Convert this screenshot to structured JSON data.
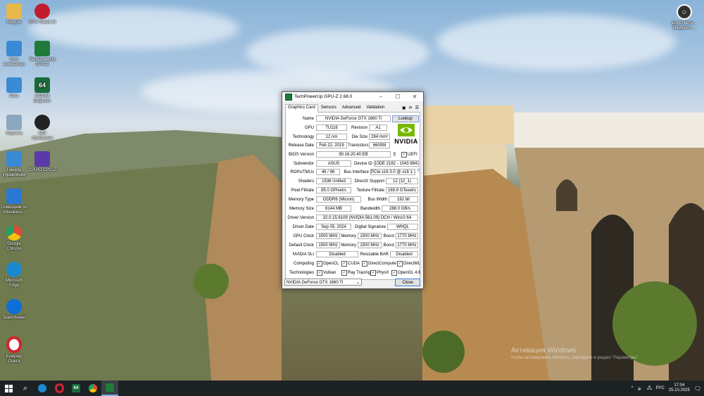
{
  "desktop_icons": [
    {
      "label": "Вхидин",
      "icon": "folder-icon",
      "color": "#e8b84a"
    },
    {
      "label": "GPU Tweak III",
      "icon": "gpu-tweak-icon",
      "color": "#c21d2e"
    },
    {
      "label": "Этот компьютер",
      "icon": "computer-icon",
      "color": "#3a8ad6"
    },
    {
      "label": "TechPowerUp GPU-Z",
      "icon": "gpuz-icon",
      "color": "#1e7b3a"
    },
    {
      "label": "Сеть",
      "icon": "network-icon",
      "color": "#3a8ad6"
    },
    {
      "label": "AIDA64 Engineer",
      "icon": "aida64-icon",
      "color": "#1a6b3a",
      "glyph": "64"
    },
    {
      "label": "Корзина",
      "icon": "recycle-bin-icon",
      "color": "#8aa7c0"
    },
    {
      "label": "MSI Afterburner",
      "icon": "afterburner-icon",
      "color": "#222222"
    },
    {
      "label": "Панель управления",
      "icon": "control-panel-icon",
      "color": "#3a8ad6"
    },
    {
      "label": "CPUID CPU-Z",
      "icon": "cpuz-icon",
      "color": "#5a3aa8"
    },
    {
      "label": "Помощник по обновлен...",
      "icon": "update-assistant-icon",
      "color": "#2b78d4"
    },
    {
      "label": "Google Chrome",
      "icon": "chrome-icon",
      "color": "#e04a3a"
    },
    {
      "label": "Microsoft Edge",
      "icon": "edge-icon",
      "color": "#1a8ad0"
    },
    {
      "label": "TeamViewer",
      "icon": "teamviewer-icon",
      "color": "#0e6fd6"
    },
    {
      "label": "Браузер Opera",
      "icon": "opera-icon",
      "color": "#d4232e"
    }
  ],
  "top_right_icon": {
    "label": "Дополните... сведения ...",
    "icon": "person-circle-icon"
  },
  "window": {
    "title": "TechPowerUp GPU-Z 2.68.0",
    "tabs": [
      "Graphics Card",
      "Sensors",
      "Advanced",
      "Validation"
    ],
    "lookup_label": "Lookup",
    "logo_text": "NVIDIA",
    "fields": {
      "name_label": "Name",
      "name": "NVIDIA GeForce GTX 1660 Ti",
      "gpu_label": "GPU",
      "gpu": "TU116",
      "revision_label": "Revision",
      "revision": "A1",
      "technology_label": "Technology",
      "technology": "12 nm",
      "die_size_label": "Die Size",
      "die_size": "284 mm²",
      "release_date_label": "Release Date",
      "release_date": "Feb 22, 2019",
      "transistors_label": "Transistors",
      "transistors": "6600M",
      "bios_label": "BIOS Version",
      "bios": "90.16.20.40.EB",
      "uefi_label": "UEFI",
      "subvendor_label": "Subvendor",
      "subvendor": "ASUS",
      "device_id_label": "Device ID",
      "device_id": "10DE 2182 - 1043 8841",
      "rops_label": "ROPs/TMUs",
      "rops": "48 / 96",
      "bus_label": "Bus Interface",
      "bus": "PCIe x16 3.0 @ x16 1.1",
      "shaders_label": "Shaders",
      "shaders": "1536 Unified",
      "directx_label": "DirectX Support",
      "directx": "12 (12_1)",
      "pixel_label": "Pixel Fillrate",
      "pixel": "85.0 GPixel/s",
      "texture_label": "Texture Fillrate",
      "texture": "169.9 GTexel/s",
      "memtype_label": "Memory Type",
      "memtype": "GDDR6 (Micron)",
      "buswidth_label": "Bus Width",
      "buswidth": "192 bit",
      "memsize_label": "Memory Size",
      "memsize": "6144 MB",
      "bandwidth_label": "Bandwidth",
      "bandwidth": "288.0 GB/s",
      "driver_label": "Driver Version",
      "driver": "32.0.15.6109 (NVIDIA 561.09) DCH / Win10 64",
      "driver_date_label": "Driver Date",
      "driver_date": "Sep 05, 2024",
      "signature_label": "Digital Signature",
      "signature": "WHQL",
      "gpu_clock_label": "GPU Clock",
      "gpu_clock": "1500 MHz",
      "memory_label": "Memory",
      "memory_clock": "1500 MHz",
      "boost_label": "Boost",
      "boost_clock": "1770 MHz",
      "default_clock_label": "Default Clock",
      "default_clock": "1500 MHz",
      "default_memory": "1500 MHz",
      "default_boost": "1770 MHz",
      "sli_label": "NVIDIA SLI",
      "sli": "Disabled",
      "rebar_label": "Resizable BAR",
      "rebar": "Disabled",
      "computing_label": "Computing",
      "technologies_label": "Technologies"
    },
    "computing": [
      "OpenCL",
      "CUDA",
      "DirectCompute",
      "DirectML"
    ],
    "technologies": [
      "Vulkan",
      "Ray Tracing",
      "PhysX",
      "OpenGL 4.6"
    ],
    "gpu_select": "NVIDIA GeForce GTX 1660 Ti",
    "close_label": "Close"
  },
  "watermark": {
    "line1": "Активация Windows",
    "line2": "Чтобы активировать Windows, перейдите в раздел \"Параметры\"."
  },
  "taskbar": {
    "apps": [
      "start-icon",
      "search-icon",
      "edge-icon",
      "opera-icon",
      "aida64-icon",
      "chrome-icon",
      "gpuz-icon"
    ],
    "lang": "РУС",
    "time": "17:04",
    "date": "25.10.2025"
  }
}
